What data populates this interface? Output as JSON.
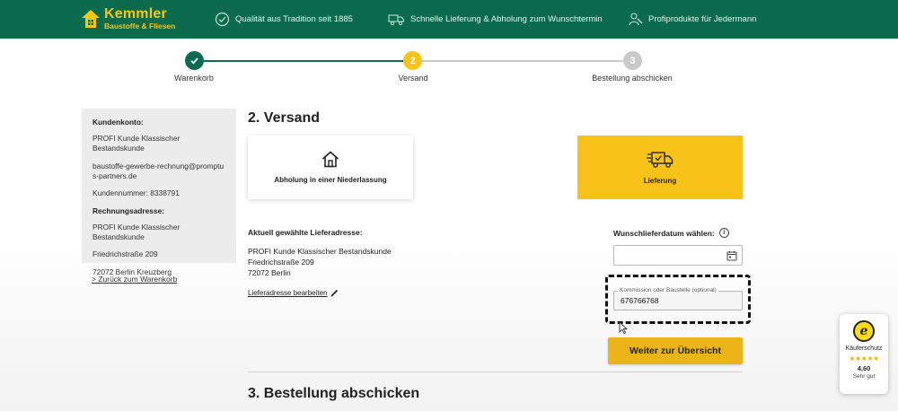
{
  "header": {
    "logo_name": "Kemmler",
    "logo_sub": "Baustoffe & Fliesen",
    "usps": [
      {
        "text": "Qualität aus Tradition seit 1885",
        "icon": "badge-check-icon"
      },
      {
        "text": "Schnelle Lieferung & Abholung zum Wunschtermin",
        "icon": "truck-clock-icon"
      },
      {
        "text": "Profiprodukte für Jedermann",
        "icon": "worker-icon"
      }
    ],
    "color": "#0c6b4c",
    "accent": "#f7c516"
  },
  "stepper": {
    "steps": [
      {
        "number": "✓",
        "label": "Warenkorb",
        "state": "done"
      },
      {
        "number": "2",
        "label": "Versand",
        "state": "active"
      },
      {
        "number": "3",
        "label": "Bestellung abschicken",
        "state": "pending"
      }
    ]
  },
  "sidebar": {
    "account_heading": "Kundenkonto:",
    "account_name": "PROFI Kunde Klassischer Bestandskunde",
    "email": "baustoffe-gewerbe-rechnung@promptus-partners.de",
    "customer_number": "Kundennummer: 8338791",
    "billing_heading": "Rechnungsadresse:",
    "billing_name": "PROFI Kunde Klassischer Bestandskunde",
    "billing_street": "Friedrichstraße 209",
    "billing_city": "72072 Berlin Kreuzberg",
    "back_link": "> Zurück zum Warenkorb"
  },
  "main": {
    "section_title": "2. Versand",
    "options": [
      {
        "label": "Abholung in einer Niederlassung",
        "icon": "home-icon",
        "selected": false
      },
      {
        "label": "Lieferung",
        "icon": "truck-icon",
        "selected": true
      }
    ],
    "address_title": "Aktuell gewählte Lieferadresse:",
    "address_name": "PROFI Kunde Klassischer Bestandskunde",
    "address_street": "Friedrichstraße 209",
    "address_city": "72072 Berlin",
    "edit_link": "Lieferadresse bearbeiten",
    "date_label": "Wunschlieferdatum wählen:",
    "info_glyph": "i",
    "date_value": "",
    "commission_label": "Kommission oder Baustelle (optional)",
    "commission_value": "676766768",
    "next_button": "Weiter zur Übersicht",
    "next_section_title": "3. Bestellung abschicken"
  },
  "trust_badge": {
    "seal": "e",
    "label": "Käuferschutz",
    "stars": "★★★★★",
    "score": "4,60",
    "rating_text": "Sehr gut"
  }
}
